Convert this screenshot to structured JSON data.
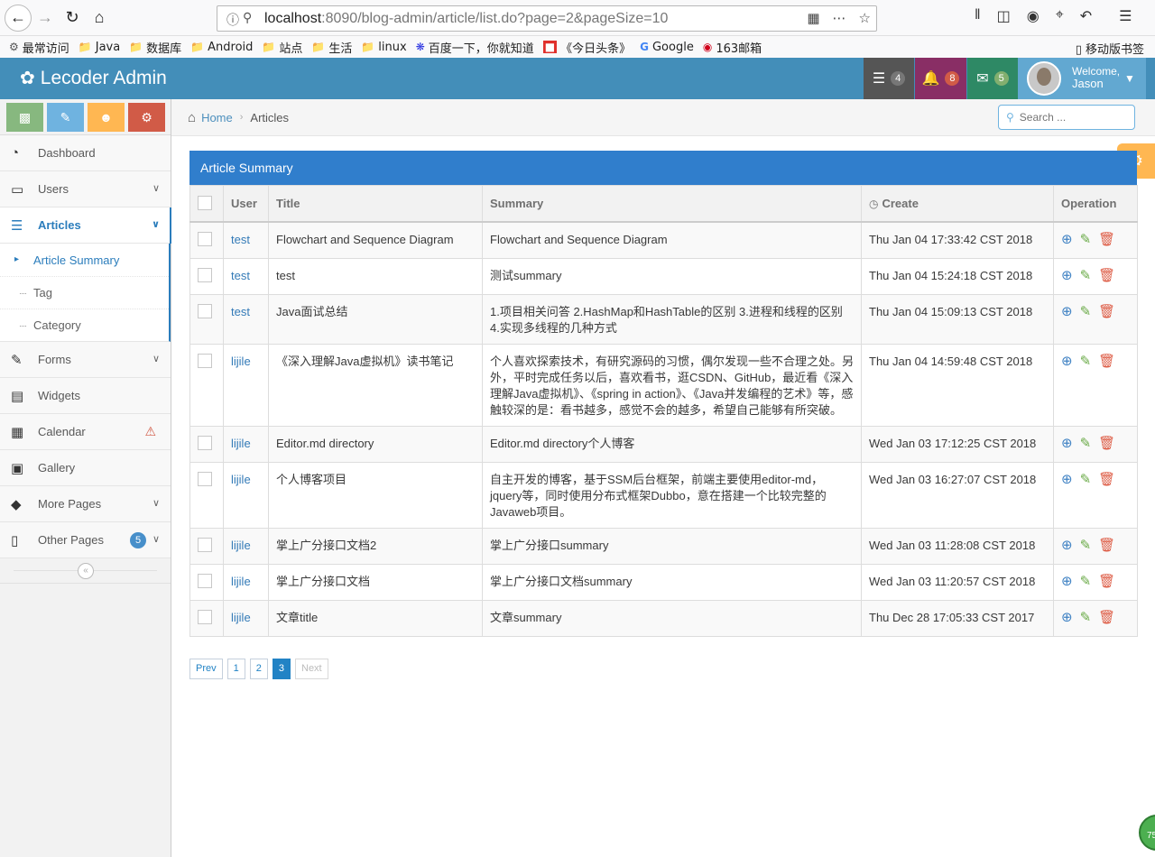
{
  "browser": {
    "url_host": "localhost",
    "url_path": ":8090/blog-admin/article/list.do?page=2&pageSize=10",
    "bookmarks": [
      "最常访问",
      "Java",
      "数据库",
      "Android",
      "站点",
      "生活",
      "linux",
      "百度一下，你就知道",
      "《今日头条》",
      "Google",
      "163邮箱"
    ],
    "mobile_bookmarks": "移动版书签"
  },
  "header": {
    "brand": "Lecoder Admin",
    "tasks_count": "4",
    "notifications_count": "8",
    "messages_count": "5",
    "welcome": "Welcome,",
    "username": "Jason",
    "colors": {
      "header": "#438eb9",
      "tasks": "#555555",
      "notifications": "#892e65",
      "messages": "#2e8965",
      "user": "#62a8d1"
    }
  },
  "sidebar": {
    "items": [
      {
        "label": "Dashboard",
        "icon": "tachometer-icon"
      },
      {
        "label": "Users",
        "icon": "desktop-icon"
      },
      {
        "label": "Articles",
        "icon": "list-icon"
      },
      {
        "label": "Forms",
        "icon": "pencil-square-icon"
      },
      {
        "label": "Widgets",
        "icon": "list-alt-icon"
      },
      {
        "label": "Calendar",
        "icon": "calendar-icon"
      },
      {
        "label": "Gallery",
        "icon": "picture-icon"
      },
      {
        "label": "More Pages",
        "icon": "tag-icon"
      },
      {
        "label": "Other Pages",
        "icon": "file-icon",
        "badge": "5"
      }
    ],
    "submenu": [
      "Article Summary",
      "Tag",
      "Category"
    ]
  },
  "breadcrumb": {
    "home": "Home",
    "current": "Articles"
  },
  "search": {
    "placeholder": "Search ..."
  },
  "panel": {
    "title": "Article Summary"
  },
  "table": {
    "headers": {
      "user": "User",
      "title": "Title",
      "summary": "Summary",
      "create": "Create",
      "operation": "Operation"
    },
    "rows": [
      {
        "user": "test",
        "title": "Flowchart and Sequence Diagram",
        "summary": "Flowchart and Sequence Diagram",
        "create": "Thu Jan 04 17:33:42 CST 2018"
      },
      {
        "user": "test",
        "title": "test",
        "summary": "测试summary",
        "create": "Thu Jan 04 15:24:18 CST 2018"
      },
      {
        "user": "test",
        "title": "Java面试总结",
        "summary": "1.项目相关问答 2.HashMap和HashTable的区别 3.进程和线程的区别 4.实现多线程的几种方式",
        "create": "Thu Jan 04 15:09:13 CST 2018"
      },
      {
        "user": "lijile",
        "title": "《深入理解Java虚拟机》读书笔记",
        "summary": "个人喜欢探索技术，有研究源码的习惯，偶尔发现一些不合理之处。另外，平时完成任务以后，喜欢看书，逛CSDN、GitHub，最近看《深入理解Java虚拟机》、《spring in action》、《Java并发编程的艺术》等，感触较深的是：看书越多，感觉不会的越多，希望自己能够有所突破。",
        "create": "Thu Jan 04 14:59:48 CST 2018"
      },
      {
        "user": "lijile",
        "title": "Editor.md directory",
        "summary": "Editor.md directory个人博客",
        "create": "Wed Jan 03 17:12:25 CST 2018"
      },
      {
        "user": "lijile",
        "title": "个人博客项目",
        "summary": "自主开发的博客，基于SSM后台框架，前端主要使用editor-md，jquery等，同时使用分布式框架Dubbo，意在搭建一个比较完整的Javaweb项目。",
        "create": "Wed Jan 03 16:27:07 CST 2018"
      },
      {
        "user": "lijile",
        "title": "掌上广分接口文档2",
        "summary": "掌上广分接口summary",
        "create": "Wed Jan 03 11:28:08 CST 2018"
      },
      {
        "user": "lijile",
        "title": "掌上广分接口文档",
        "summary": "掌上广分接口文档summary",
        "create": "Wed Jan 03 11:20:57 CST 2018"
      },
      {
        "user": "lijile",
        "title": "文章title",
        "summary": "文章summary",
        "create": "Thu Dec 28 17:05:33 CST 2017"
      }
    ]
  },
  "pagination": {
    "prev": "Prev",
    "pages": [
      "1",
      "2",
      "3"
    ],
    "active": "3",
    "next": "Next"
  },
  "corner_badge": "75"
}
